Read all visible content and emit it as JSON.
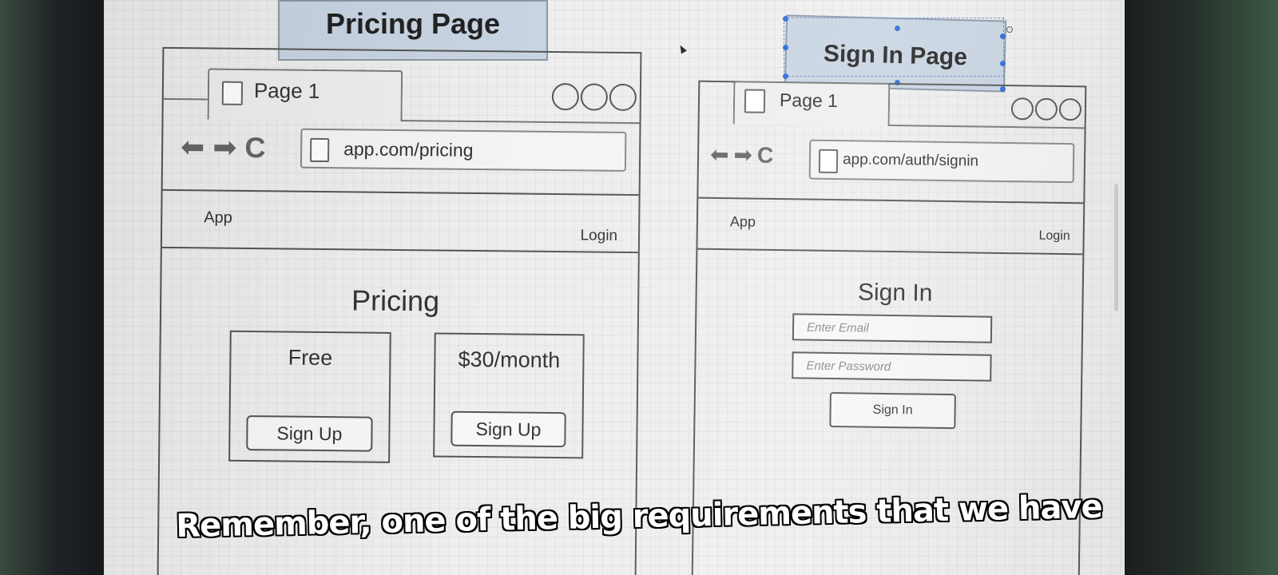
{
  "pricing_page": {
    "label": "Pricing Page",
    "tab_label": "Page 1",
    "url": "app.com/pricing",
    "nav_brand": "App",
    "nav_login": "Login",
    "title": "Pricing",
    "plans": [
      {
        "name": "Free",
        "button": "Sign Up"
      },
      {
        "name": "$30/month",
        "button": "Sign Up"
      }
    ]
  },
  "signin_page": {
    "label": "Sign In Page",
    "tab_label": "Page 1",
    "url": "app.com/auth/signin",
    "nav_brand": "App",
    "nav_login": "Login",
    "title": "Sign In",
    "email_placeholder": "Enter Email",
    "password_placeholder": "Enter Password",
    "submit_label": "Sign In"
  },
  "subtitle": "Remember, one of the big requirements that we have",
  "icons": {
    "back": "left-arrow-icon",
    "forward": "right-arrow-icon",
    "reload": "reload-icon",
    "page": "page-icon",
    "window_controls": "window-control-circles"
  },
  "colors": {
    "label_fill": "#c8d4e2",
    "wire_stroke": "#555555",
    "canvas": "#eeeeee",
    "selection": "#2a6ad8"
  }
}
